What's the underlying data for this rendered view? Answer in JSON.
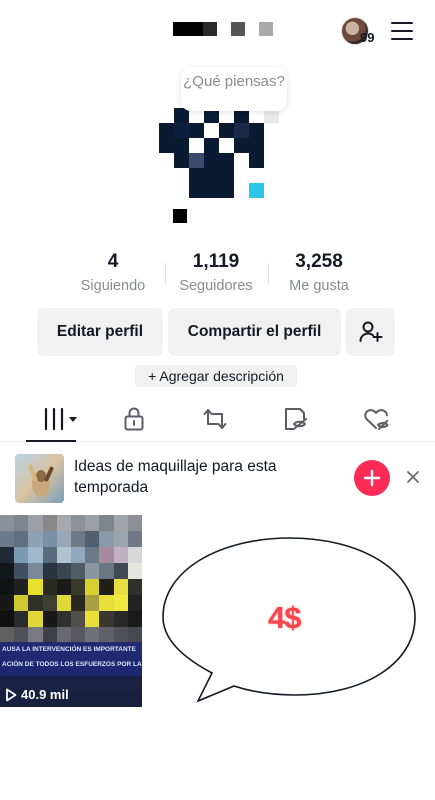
{
  "header": {
    "friends_badge_count": "99"
  },
  "profile": {
    "note_bubble": "¿Qué piensas?"
  },
  "stats": [
    {
      "value": "4",
      "label": "Siguiendo"
    },
    {
      "value": "1,119",
      "label": "Seguidores"
    },
    {
      "value": "3,258",
      "label": "Me gusta"
    }
  ],
  "actions": {
    "edit_profile": "Editar perfil",
    "share_profile": "Compartir el perfil",
    "add_description": "+ Agregar descripción"
  },
  "tabs": [
    {
      "icon": "grid-icon",
      "active": true
    },
    {
      "icon": "lock-icon"
    },
    {
      "icon": "repost-icon"
    },
    {
      "icon": "eye-off-icon"
    },
    {
      "icon": "liked-icon"
    }
  ],
  "banner": {
    "text": "Ideas de maquillaje para esta temporada",
    "accent_color": "#fe2c55"
  },
  "video": {
    "views": "40.9 mil",
    "caption_line1": "AUSA LA INTERVENCIÓN ES IMPORTANTE",
    "caption_line2": "ACIÓN DE TODOS LOS ESFUERZOS POR LA LIB"
  },
  "overlay": {
    "price": "4$"
  }
}
